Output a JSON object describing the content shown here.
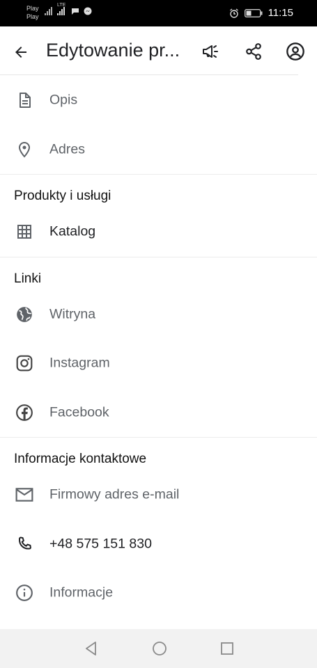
{
  "status_bar": {
    "carrier_top": "Play",
    "carrier_bottom": "Play",
    "network": "LTE",
    "time": "11:15"
  },
  "app_bar": {
    "title": "Edytowanie pr...",
    "icons": [
      "arrow-back-icon",
      "megaphone-icon",
      "share-icon",
      "account-circle-icon"
    ]
  },
  "sections": {
    "top": {
      "items": [
        {
          "label": "Opis",
          "icon": "document-icon"
        },
        {
          "label": "Adres",
          "icon": "location-pin-icon"
        }
      ]
    },
    "products": {
      "header": "Produkty i usługi",
      "items": [
        {
          "label": "Katalog",
          "icon": "grid-icon"
        }
      ]
    },
    "links": {
      "header": "Linki",
      "items": [
        {
          "label": "Witryna",
          "icon": "globe-icon"
        },
        {
          "label": "Instagram",
          "icon": "instagram-icon"
        },
        {
          "label": "Facebook",
          "icon": "facebook-icon"
        }
      ]
    },
    "contact": {
      "header": "Informacje kontaktowe",
      "items": [
        {
          "label": "Firmowy adres e-mail",
          "icon": "mail-icon"
        },
        {
          "label": "+48 575 151 830",
          "icon": "phone-icon"
        },
        {
          "label": "Informacje",
          "icon": "info-icon"
        }
      ]
    }
  },
  "nav_bar": {
    "icons": [
      "back-triangle-icon",
      "home-circle-icon",
      "recents-square-icon"
    ]
  }
}
